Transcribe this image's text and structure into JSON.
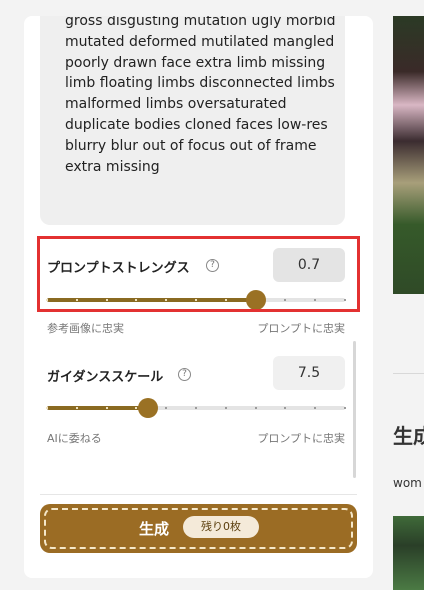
{
  "negative_prompt": {
    "lines": [
      "gross disgusting mutation ugly morbid",
      "mutated deformed mutilated mangled",
      "poorly drawn face extra limb missing",
      "limb floating limbs disconnected limbs",
      "malformed limbs oversaturated",
      "duplicate bodies cloned faces low-res",
      "blurry blur out of focus out of frame",
      "extra missing"
    ]
  },
  "prompt_strength": {
    "label": "プロンプトストレングス",
    "help_icon": "?",
    "value": "0.7",
    "slider_fraction": 0.7,
    "min_label": "参考画像に忠実",
    "max_label": "プロンプトに忠実"
  },
  "guidance_scale": {
    "label": "ガイダンススケール",
    "help_icon": "?",
    "value": "7.5",
    "slider_fraction": 0.34,
    "min_label": "AIに委ねる",
    "max_label": "プロンプトに忠実"
  },
  "generate_button": {
    "label": "生成",
    "badge": "残り0枚"
  },
  "right_column": {
    "heading": "生成",
    "subtext": "wom"
  },
  "colors": {
    "accent": "#9b6c24",
    "highlight": "#e33131",
    "value_box_bg": "#e4e4e4",
    "panel_bg": "#ffffff"
  }
}
